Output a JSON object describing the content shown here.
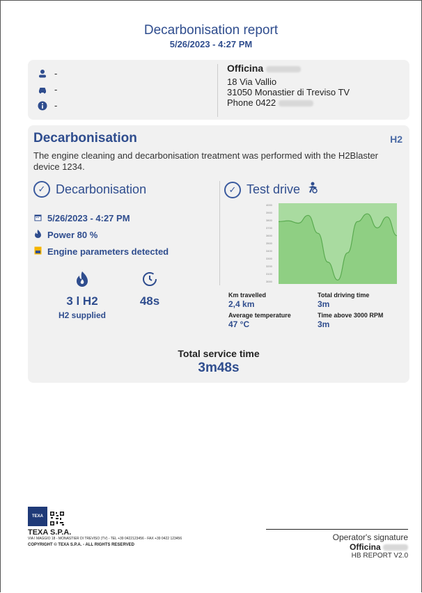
{
  "header": {
    "title": "Decarbonisation report",
    "datetime": "5/26/2023 - 4:27 PM"
  },
  "info": {
    "customer": "-",
    "vehicle": "-",
    "details": "-",
    "workshop_name": "Officina",
    "address1": "18 Via Vallio",
    "address2": "31050 Monastier di Treviso TV",
    "phone": "Phone 0422"
  },
  "main": {
    "heading": "Decarbonisation",
    "description": "The engine cleaning and decarbonisation treatment was performed with the H2Blaster device 1234.",
    "logo_text": "H2",
    "decarb": {
      "heading": "Decarbonisation",
      "date": "5/26/2023 - 4:27 PM",
      "power": "Power 80 %",
      "engine": "Engine parameters detected",
      "h2_value": "3 l H2",
      "h2_label": "H2 supplied",
      "time_value": "48s"
    },
    "testdrive": {
      "heading": "Test drive",
      "km_label": "Km travelled",
      "km_value": "2,4 km",
      "driving_label": "Total driving time",
      "driving_value": "3m",
      "temp_label": "Average temperature",
      "temp_value": "47 °C",
      "above_label": "Time above 3000 RPM",
      "above_value": "3m"
    },
    "total_label": "Total service time",
    "total_value": "3m48s"
  },
  "chart_data": {
    "type": "line",
    "title": "",
    "xlabel": "",
    "ylabel": "",
    "ylim": [
      2000,
      4000
    ],
    "yticks": [
      "4000",
      "3900",
      "3800",
      "3700",
      "3600",
      "3500",
      "3400",
      "3300",
      "3200",
      "3100",
      "3000"
    ],
    "series": [
      {
        "values": [
          3800,
          3810,
          3780,
          3880,
          3650,
          3280,
          3050,
          3400,
          3800,
          3900,
          3720,
          3860,
          3620
        ]
      }
    ]
  },
  "footer": {
    "company": "TEXA S.P.A.",
    "address": "VIA I MAGGIO 18 - MONASTIER DI TREVISO (TV) - TEL +39 0422123456 - FAX +39 0422 123456",
    "copyright": "COPYRIGHT © TEXA S.P.A. - ALL RIGHTS RESERVED",
    "signature_label": "Operator's signature",
    "signature_name": "Officina",
    "version": "HB REPORT V2.0",
    "logo_text": "TEXA"
  },
  "colors": {
    "accent": "#2f4d8e",
    "chart_fill": "#8fcf83"
  }
}
